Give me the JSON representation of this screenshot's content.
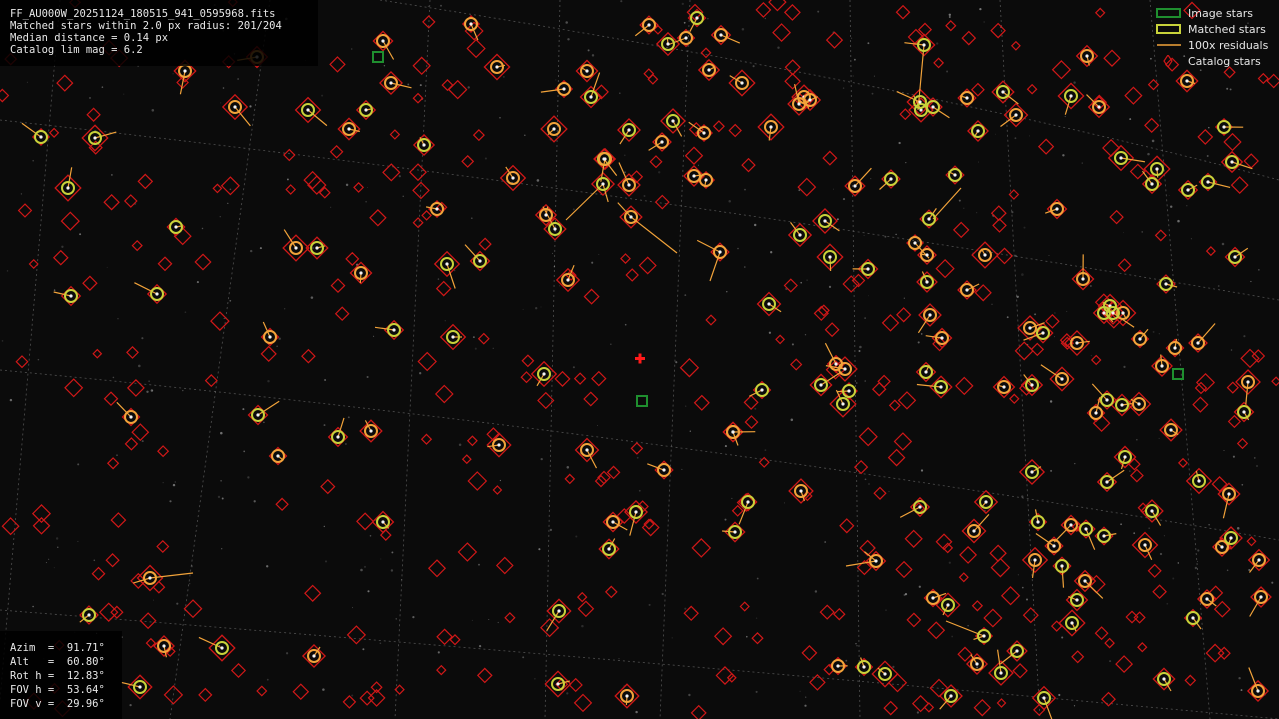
{
  "info": {
    "filename": "FF_AU000W_20251124_180515_941_0595968.fits",
    "matched": "Matched stars within 2.0 px radius: 201/204",
    "median": "Median distance = 0.14 px",
    "catalog_lim": "Catalog lim mag = 6.2"
  },
  "pointing": {
    "azim": "Azim  =  91.71°",
    "alt": "Alt   =  60.80°",
    "rot": "Rot h =  12.83°",
    "fov_h": "FOV h =  53.64°",
    "fov_v": "FOV v =  29.96°"
  },
  "legend": {
    "image_stars": "Image stars",
    "matched_stars": "Matched stars",
    "residuals": "100x residuals",
    "catalog_stars": "Catalog stars"
  },
  "colors": {
    "image_star": "#1f8f2f",
    "matched_star": "#c8d23a",
    "residual": "#f2a33a",
    "catalog_star": "#d01818",
    "center_marker": "#ff1a1a"
  }
}
